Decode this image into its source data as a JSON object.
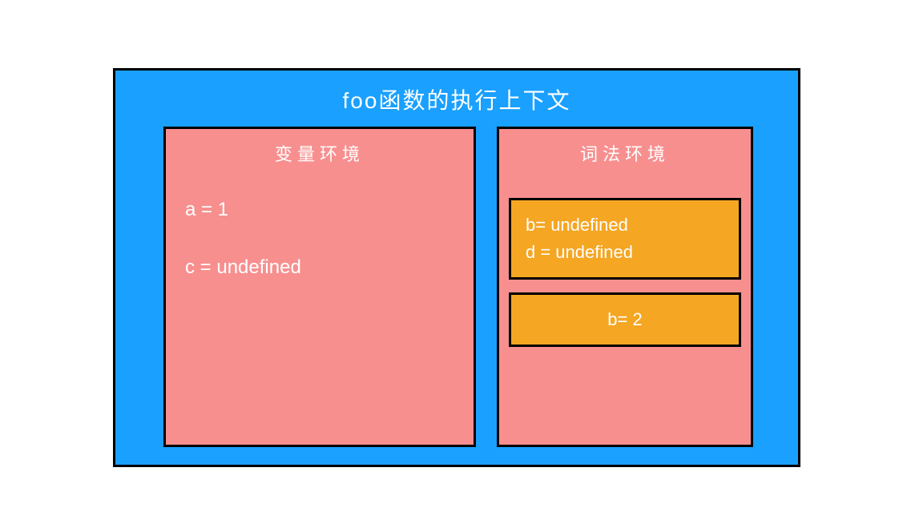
{
  "context": {
    "title": "foo函数的执行上下文",
    "variable_env": {
      "title": "变量环境",
      "lines": {
        "a": "a = 1",
        "c": "c = undefined"
      }
    },
    "lexical_env": {
      "title": "词法环境",
      "inner_scope": {
        "b": "b= undefined",
        "d": "d = undefined"
      },
      "outer_scope": {
        "b": "b= 2"
      }
    }
  }
}
